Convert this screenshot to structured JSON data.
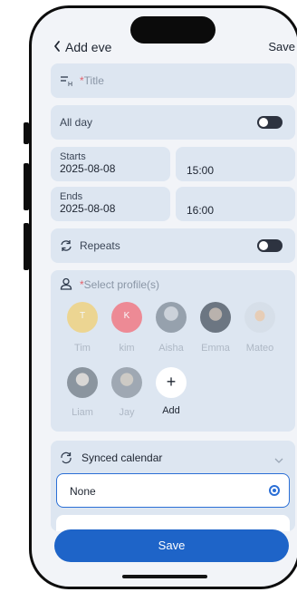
{
  "header": {
    "back_icon": "chevron-left-icon",
    "title": "Add eve",
    "save": "Save"
  },
  "form": {
    "title_required": "*",
    "title_placeholder": "Title",
    "all_day_label": "All day",
    "all_day_on": false,
    "starts_label": "Starts",
    "starts_date": "2025-08-08",
    "starts_time": "15:00",
    "ends_label": "Ends",
    "ends_date": "2025-08-08",
    "ends_time": "16:00",
    "repeats_label": "Repeats",
    "repeats_on": false
  },
  "profiles": {
    "label_required": "*",
    "label": "Select profile(s)",
    "people": [
      {
        "name": "Tim",
        "initial": "T",
        "color": "#f3cf6b"
      },
      {
        "name": "kim",
        "initial": "K",
        "color": "#f07a85"
      },
      {
        "name": "Aisha",
        "initial": "",
        "color": "#8f9aa6"
      },
      {
        "name": "Emma",
        "initial": "",
        "color": "#6b7480"
      },
      {
        "name": "Mateo",
        "initial": "",
        "color": "#cfd8e3"
      },
      {
        "name": "Liam",
        "initial": "",
        "color": "#8c96a1"
      },
      {
        "name": "Jay",
        "initial": "",
        "color": "#9aa4af"
      }
    ],
    "add_label": "Add"
  },
  "synced_calendar": {
    "label": "Synced calendar",
    "selected_option": "None"
  },
  "footer": {
    "save_label": "Save"
  },
  "colors": {
    "accent": "#1e64c8",
    "card_bg": "#dde6f1",
    "page_bg": "#f2f4f8",
    "required": "#e3616c"
  }
}
